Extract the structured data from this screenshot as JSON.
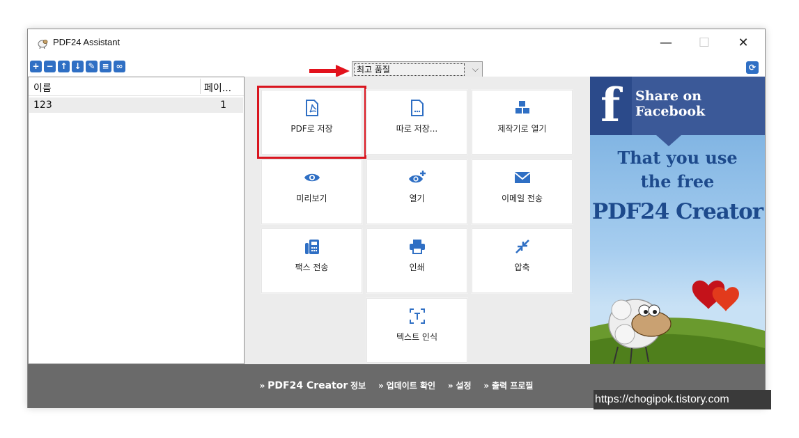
{
  "window": {
    "title": "PDF24 Assistant",
    "minimize_glyph": "—",
    "maximize_glyph": "☐",
    "close_glyph": "✕"
  },
  "toolbar": {
    "buttons": [
      {
        "name": "add-icon",
        "glyph": "+"
      },
      {
        "name": "remove-icon",
        "glyph": "−"
      },
      {
        "name": "move-up-icon",
        "glyph": "↑"
      },
      {
        "name": "move-down-icon",
        "glyph": "↓"
      },
      {
        "name": "edit-icon",
        "glyph": "✎"
      },
      {
        "name": "list-icon",
        "glyph": "≡"
      },
      {
        "name": "combine-icon",
        "glyph": "∞"
      }
    ]
  },
  "file_list": {
    "col_name": "이름",
    "col_pages": "페이...",
    "rows": [
      {
        "name": "123",
        "pages": "1"
      }
    ]
  },
  "quality": {
    "selected": "최고 품질",
    "caret": "⌵"
  },
  "tiles": [
    {
      "label": "PDF로 저장",
      "icon": "pdf-file-icon",
      "selected": true
    },
    {
      "label": "따로 저장...",
      "icon": "save-as-file-icon",
      "selected": false
    },
    {
      "label": "제작기로 열기",
      "icon": "cubes-icon",
      "selected": false
    },
    {
      "label": "미리보기",
      "icon": "eye-icon",
      "selected": false
    },
    {
      "label": "열기",
      "icon": "eye-plus-icon",
      "selected": false
    },
    {
      "label": "이메일 전송",
      "icon": "envelope-icon",
      "selected": false
    },
    {
      "label": "팩스 전송",
      "icon": "fax-icon",
      "selected": false
    },
    {
      "label": "인쇄",
      "icon": "printer-icon",
      "selected": false
    },
    {
      "label": "압축",
      "icon": "compress-icon",
      "selected": false
    },
    {
      "label": "텍스트 인식",
      "icon": "ocr-text-icon",
      "selected": false
    }
  ],
  "ad": {
    "fb_letter": "f",
    "share": "Share on Facebook",
    "line1": "That you use",
    "line2": "the free",
    "creator": "PDF24 Creator"
  },
  "footer": {
    "bullet": "»",
    "brand": "PDF24 Creator",
    "info": "정보",
    "update": "업데이트 확인",
    "settings": "설정",
    "profiles": "출력 프로필"
  },
  "watermark": "https://chogipok.tistory.com",
  "colors": {
    "accent": "#2f6fc4",
    "highlight": "#d9151f",
    "footer": "#6a6a6a",
    "facebook": "#3b5998"
  }
}
